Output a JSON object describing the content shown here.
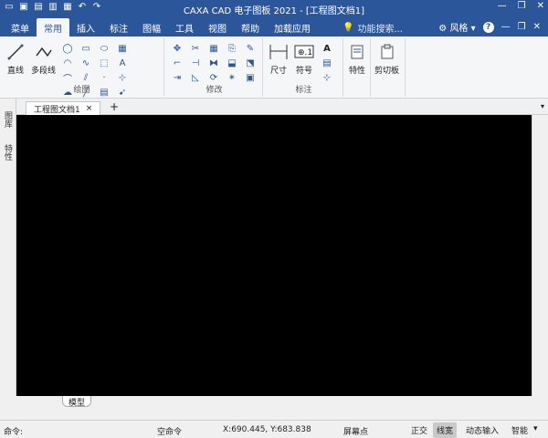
{
  "window": {
    "title": "CAXA CAD 电子图板 2021 - [工程图文档1]",
    "buttons": {
      "minimize": "—",
      "restore": "❐",
      "close": "✕"
    }
  },
  "quick_access": [
    "new-icon",
    "open-icon",
    "save-icon",
    "saveas-icon",
    "print-icon",
    "undo-icon",
    "redo-icon"
  ],
  "menu": {
    "tabs": [
      "菜单",
      "常用",
      "插入",
      "标注",
      "图幅",
      "工具",
      "视图",
      "帮助",
      "加载应用"
    ],
    "active": "常用",
    "search_placeholder": "功能搜索...",
    "style_label": "风格",
    "help_label": "?"
  },
  "ribbon": {
    "draw": {
      "label": "绘图",
      "line": "直线",
      "polyline": "多段线"
    },
    "modify": {
      "label": "修改"
    },
    "annotate": {
      "label": "标注",
      "dimension": "尺寸",
      "symbol": "符号"
    },
    "properties": {
      "label": "特性"
    },
    "clipboard": {
      "label": "剪切板"
    }
  },
  "side_panels": [
    "图库",
    "特性"
  ],
  "document": {
    "tab": "工程图文档1",
    "close": "×",
    "add": "+"
  },
  "layout_tab": "模型",
  "statusbar": {
    "command": "命令:",
    "empty_command": "空命令",
    "coords": "X:690.445, Y:683.838",
    "snap": "屏幕点",
    "ortho": "正交",
    "lineweight": "线宽",
    "dynamic_input": "动态输入",
    "smart": "智能"
  }
}
